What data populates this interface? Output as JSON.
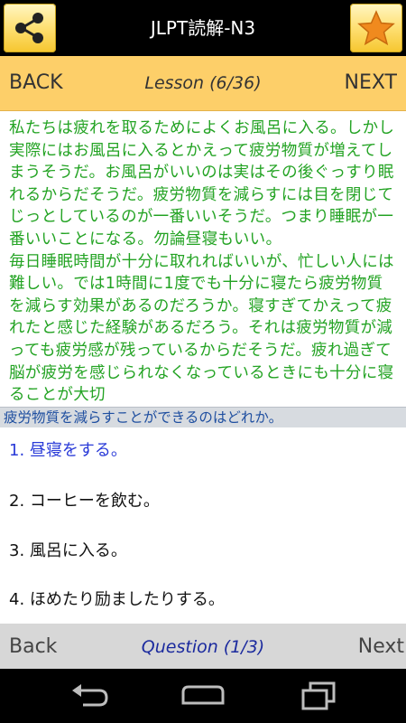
{
  "appbar": {
    "title": "JLPT読解-N3",
    "share_icon": "share-icon",
    "favorite_icon": "star-icon"
  },
  "lesson_nav": {
    "back_label": "BACK",
    "lesson_label": "Lesson (6/36)",
    "next_label": "NEXT"
  },
  "passage": {
    "paragraphs": [
      "私たちは疲れを取るためによくお風呂に入る。しかし実際にはお風呂に入るとかえって疲労物質が増えてしまうそうだ。お風呂がいいのは実はその後ぐっすり眠れるからだそうだ。疲労物質を減らすには目を閉じてじっとしているのが一番いいそうだ。つまり睡眠が一番いいことになる。勿論昼寝もいい。",
      "毎日睡眠時間が十分に取れればいいが、忙しい人には難しい。では1時間に1度でも十分に寝たら疲労物質を減らす効果があるのだろうか。寝すぎてかえって疲れたと感じた経験があるだろう。それは疲労物質が減っても疲労感が残っているからだそうだ。疲れ過ぎて脳が疲労を感じられなくなっているときにも十分に寝ることが大切"
    ]
  },
  "question": {
    "prompt": "疲労物質を減らすことができるのはどれか。",
    "answers": [
      "1.  昼寝をする。",
      "2.  コーヒーを飲む。",
      "3.  風呂に入る。",
      "4.  ほめたり励ましたりする。"
    ],
    "selected_index": 0
  },
  "question_nav": {
    "back_label": "Back",
    "question_label": "Question (1/3)",
    "next_label": "Next"
  },
  "system_nav": {
    "back_icon": "back-arrow-icon",
    "home_icon": "home-icon",
    "recents_icon": "recent-apps-icon"
  },
  "colors": {
    "lesson_bar": "#fdcf69",
    "passage_text": "#23a323",
    "selected_answer": "#2a3bd8",
    "question_label": "#1b2a9e"
  }
}
